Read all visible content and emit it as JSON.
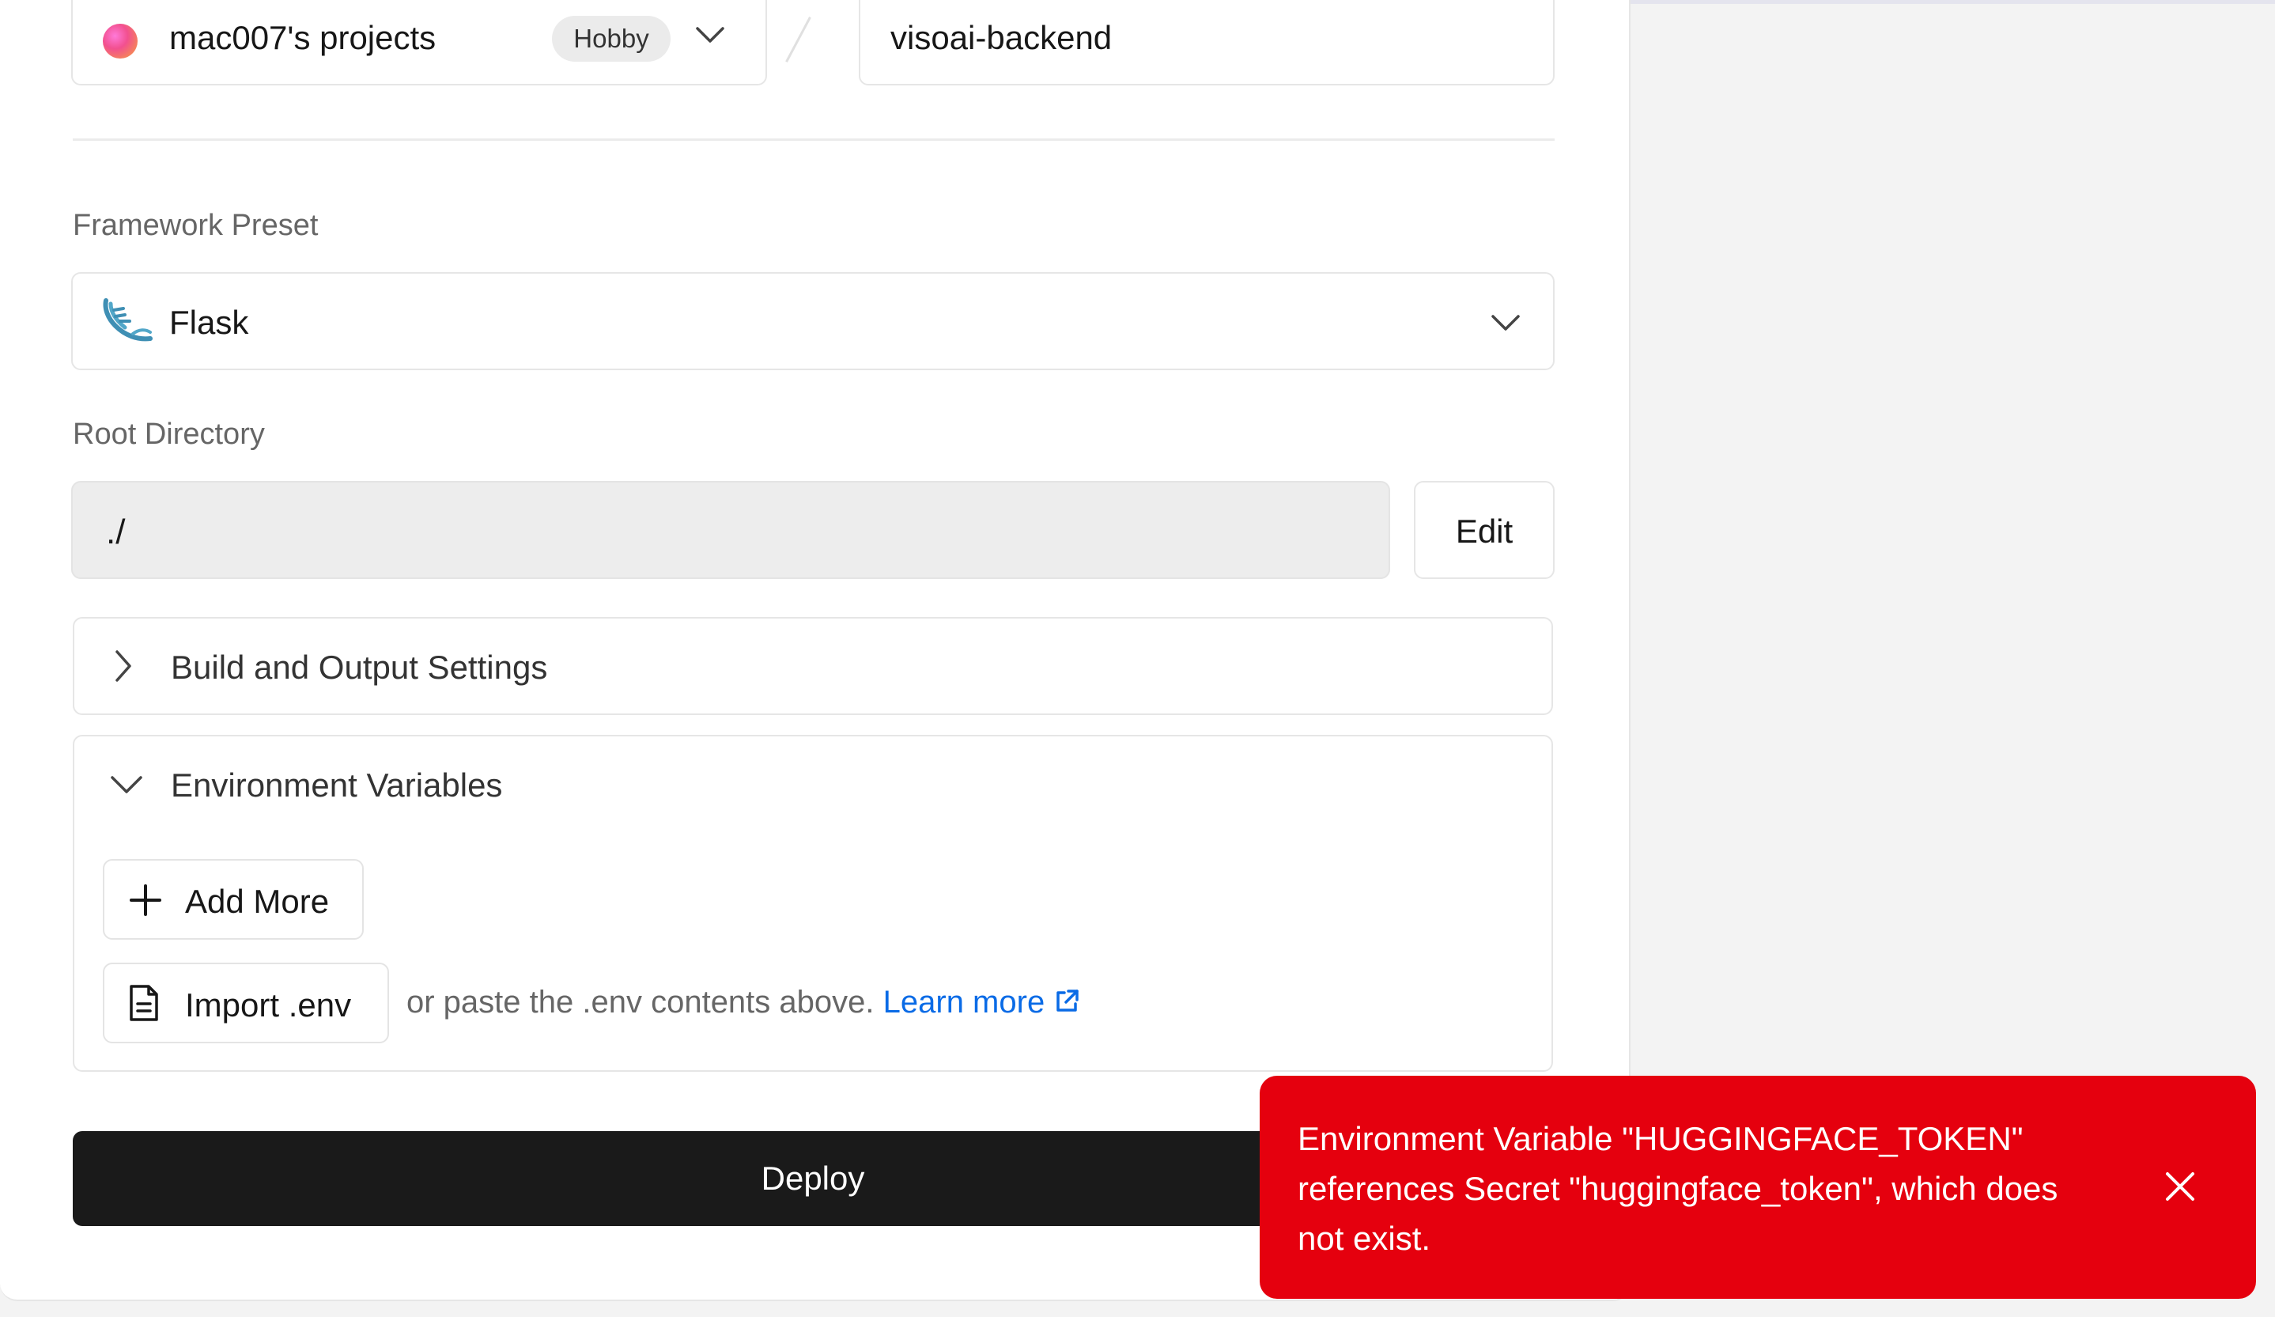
{
  "team_select": {
    "name": "mac007's projects",
    "plan_badge": "Hobby"
  },
  "repository": {
    "name": "visoai-backend"
  },
  "framework": {
    "label": "Framework Preset",
    "selected": "Flask"
  },
  "root_directory": {
    "label": "Root Directory",
    "value": "./",
    "edit_label": "Edit"
  },
  "build_settings": {
    "title": "Build and Output Settings",
    "expanded": false
  },
  "env_vars": {
    "title": "Environment Variables",
    "expanded": true,
    "add_more_label": "Add More",
    "import_label": "Import .env",
    "paste_hint": "or paste the .env contents above.",
    "learn_more_label": "Learn more"
  },
  "deploy": {
    "label": "Deploy"
  },
  "toast": {
    "message": "Environment Variable \"HUGGINGFACE_TOKEN\" references Secret \"huggingface_token\", which does not exist.",
    "color": "#e5000e"
  },
  "colors": {
    "accent_link": "#0a6be6",
    "deploy_bg": "#1a1a1a",
    "error": "#e5000e"
  },
  "icons": [
    "team-avatar",
    "chevron-down-icon",
    "flask-logo-icon",
    "chevron-right-icon",
    "plus-icon",
    "file-icon",
    "external-link-icon",
    "close-icon"
  ]
}
